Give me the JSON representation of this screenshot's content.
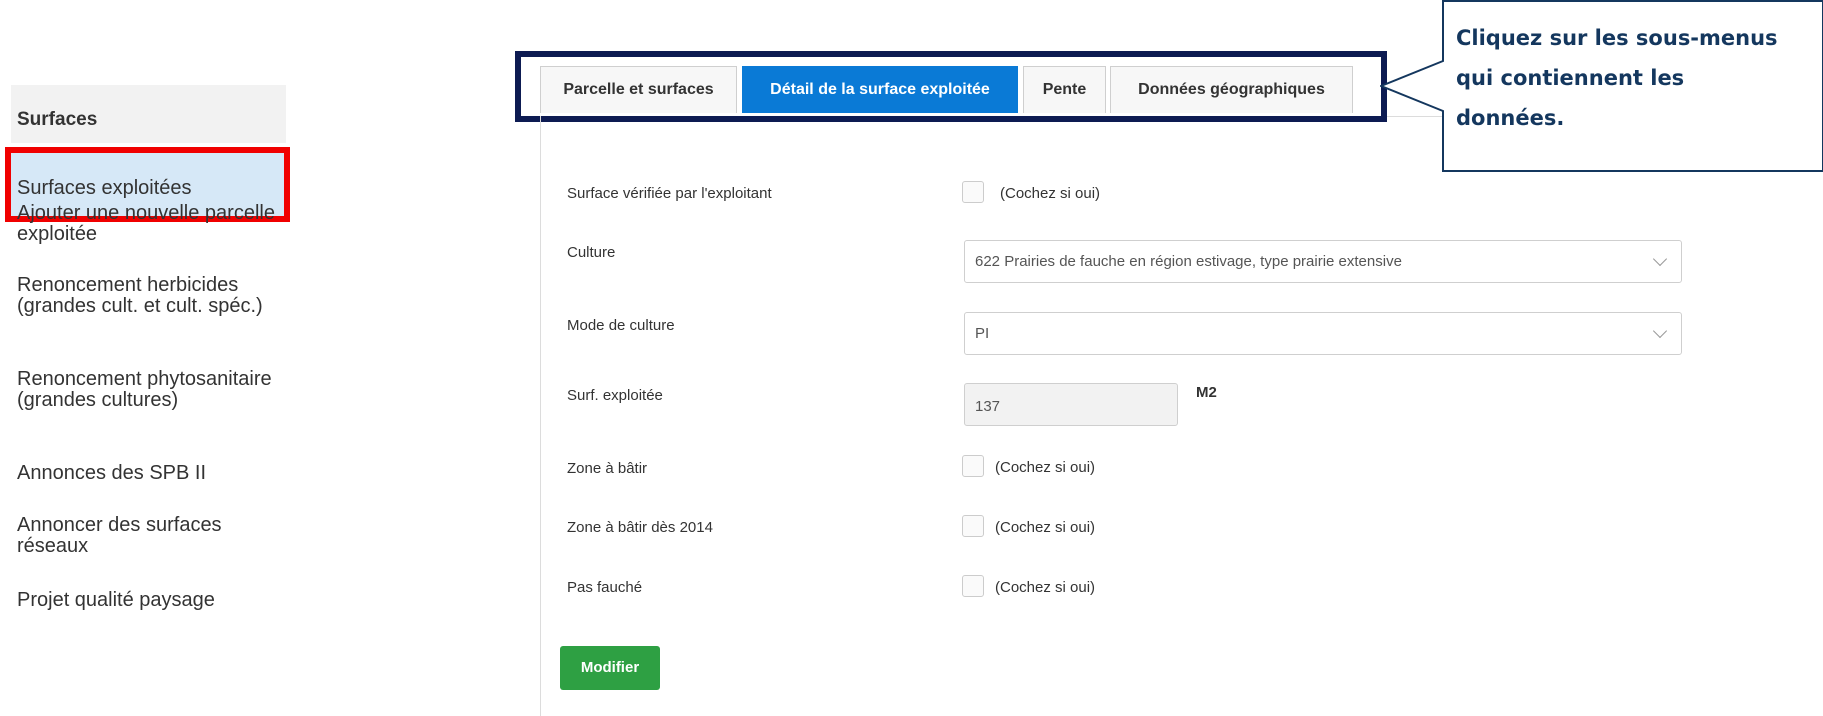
{
  "sidebar": {
    "heading": "Surfaces",
    "active_item": "Surfaces exploitées",
    "items": [
      "Ajouter une nouvelle parcelle exploitée",
      "Renoncement herbicides (grandes cult. et cult. spéc.)",
      "Renoncement phytosanitaire (grandes cultures)",
      "Annonces des SPB II",
      "Annoncer des surfaces réseaux",
      "Projet qualité paysage"
    ]
  },
  "tabs": [
    {
      "label": "Parcelle et surfaces",
      "active": false
    },
    {
      "label": "Détail de la surface exploitée",
      "active": true
    },
    {
      "label": "Pente",
      "active": false
    },
    {
      "label": "Données géographiques",
      "active": false
    }
  ],
  "form": {
    "surface_verifiee": {
      "label": "Surface vérifiée par l'exploitant",
      "hint": "(Cochez si oui)",
      "checked": false
    },
    "culture": {
      "label": "Culture",
      "value": "622 Prairies de fauche en région estivage, type prairie extensive"
    },
    "mode_culture": {
      "label": "Mode de culture",
      "value": "PI"
    },
    "surf_exploitee": {
      "label": "Surf. exploitée",
      "value": "137",
      "unit": "M2"
    },
    "zone_batir": {
      "label": "Zone à bâtir",
      "hint": "(Cochez si oui)",
      "checked": false
    },
    "zone_batir_2014": {
      "label": "Zone à bâtir dès 2014",
      "hint": "(Cochez si oui)",
      "checked": false
    },
    "pas_fauche": {
      "label": "Pas fauché",
      "hint": "(Cochez si oui)",
      "checked": false
    },
    "submit_label": "Modifier"
  },
  "callout": {
    "text": "Cliquez sur les sous-menus qui contiennent les données."
  },
  "colors": {
    "active_tab": "#0a7ad6",
    "tab_highlight_frame": "#0d1b52",
    "sidebar_highlight_frame": "#f00000",
    "submit_button": "#2ea043",
    "callout_text": "#14375e"
  }
}
